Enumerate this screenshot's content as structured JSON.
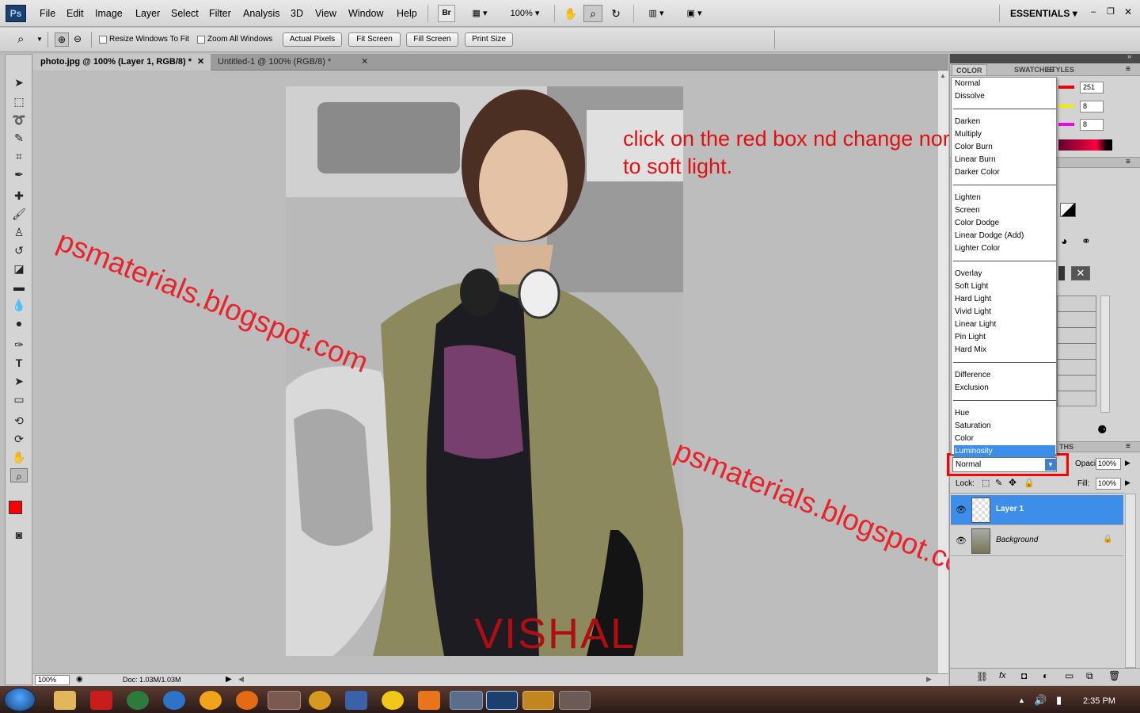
{
  "app": {
    "logo": "Ps"
  },
  "menu": [
    "File",
    "Edit",
    "Image",
    "Layer",
    "Select",
    "Filter",
    "Analysis",
    "3D",
    "View",
    "Window",
    "Help"
  ],
  "menubar": {
    "bridge_label": "Br",
    "zoom_value": "100%",
    "workspace": "ESSENTIALS"
  },
  "options": {
    "resize_windows": "Resize Windows To Fit",
    "zoom_all": "Zoom All Windows",
    "actual_pixels": "Actual Pixels",
    "fit_screen": "Fit Screen",
    "fill_screen": "Fill Screen",
    "print_size": "Print Size"
  },
  "tabs": [
    "photo.jpg @ 100% (Layer 1, RGB/8) *",
    "Untitled-1 @ 100% (RGB/8) *"
  ],
  "canvas": {
    "watermark_1": "psmaterials.blogspot.com",
    "watermark_2": "psmaterials.blogspot.com",
    "instruction_line1": "click on the red box nd change normal",
    "instruction_line2": "to soft light.",
    "photo_caption": "VISHAL"
  },
  "status": {
    "zoom": "100%",
    "doc": "Doc: 1.03M/1.03M"
  },
  "panels": {
    "tabs": [
      "COLOR",
      "SWATCHES",
      "STYLES"
    ],
    "color_values": [
      "251",
      "8",
      "8"
    ],
    "layers_tab_partial": "THS"
  },
  "blend_modes": {
    "groups": [
      [
        "Normal",
        "Dissolve"
      ],
      [
        "Darken",
        "Multiply",
        "Color Burn",
        "Linear Burn",
        "Darker Color"
      ],
      [
        "Lighten",
        "Screen",
        "Color Dodge",
        "Linear Dodge (Add)",
        "Lighter Color"
      ],
      [
        "Overlay",
        "Soft Light",
        "Hard Light",
        "Vivid Light",
        "Linear Light",
        "Pin Light",
        "Hard Mix"
      ],
      [
        "Difference",
        "Exclusion"
      ],
      [
        "Hue",
        "Saturation",
        "Color",
        "Luminosity"
      ]
    ],
    "highlighted": "Luminosity"
  },
  "layers": {
    "blend_value": "Normal",
    "opacity_label": "Opacity:",
    "opacity_value": "100%",
    "lock_label": "Lock:",
    "fill_label": "Fill:",
    "fill_value": "100%",
    "items": [
      {
        "name": "Layer 1",
        "selected": true
      },
      {
        "name": "Background",
        "selected": false
      }
    ]
  },
  "taskbar": {
    "time": "2:35 PM"
  },
  "colors": {
    "accent_red": "#ff0000",
    "selection_blue": "#3d8ee8",
    "foreground_swatch": "#ff0000"
  }
}
